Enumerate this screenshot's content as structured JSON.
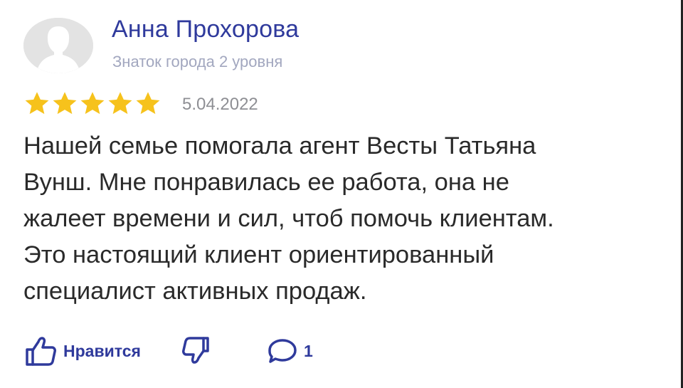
{
  "author": {
    "name": "Анна Прохорова",
    "rank": "Знаток города 2 уровня"
  },
  "review": {
    "rating": 5,
    "date": "5.04.2022",
    "text": "Нашей семье помогала агент Весты Татьяна\nВунш. Мне понравилась ее работа, она не\nжалеет времени и сил, чтоб помочь клиентам.\nЭто настоящий клиент ориентированный\nспециалист активных продаж."
  },
  "actions": {
    "like_label": "Нравится",
    "comment_count": "1"
  },
  "icons": {
    "avatar": "user-silhouette-icon",
    "star": "star-icon",
    "like": "thumbs-up-icon",
    "dislike": "thumbs-down-icon",
    "comments": "comment-bubble-icon"
  },
  "colors": {
    "accent": "#2f3a9c",
    "star": "#f6c21c",
    "muted": "#a2a7bf",
    "date": "#8e8f94",
    "text": "#2a2a2a",
    "avatar_bg": "#e3e3e3"
  }
}
